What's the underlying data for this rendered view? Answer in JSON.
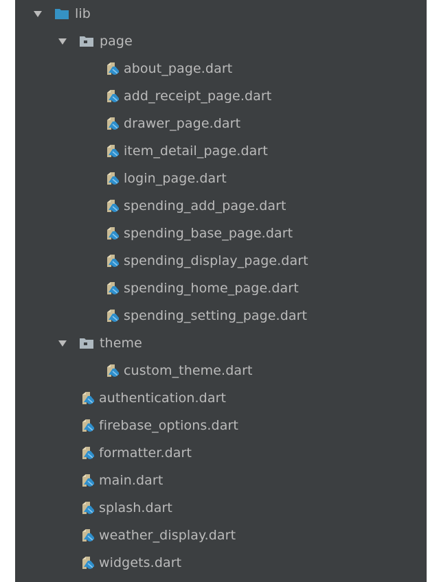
{
  "colors": {
    "background": "#3c3f41",
    "text": "#bbbbbb",
    "root_folder": "#3592c4",
    "package_folder": "#aeb9c0",
    "dart_file_tan": "#c9bb95",
    "dart_file_blue": "#2e8fcc"
  },
  "tree": [
    {
      "type": "folder",
      "label": "lib",
      "icon": "folder-icon",
      "expanded": true,
      "depth": 0
    },
    {
      "type": "package",
      "label": "page",
      "icon": "package-folder-icon",
      "expanded": true,
      "depth": 1
    },
    {
      "type": "file",
      "label": "about_page.dart",
      "icon": "dart-file-icon",
      "depth": 2
    },
    {
      "type": "file",
      "label": "add_receipt_page.dart",
      "icon": "dart-file-icon",
      "depth": 2
    },
    {
      "type": "file",
      "label": "drawer_page.dart",
      "icon": "dart-file-icon",
      "depth": 2
    },
    {
      "type": "file",
      "label": "item_detail_page.dart",
      "icon": "dart-file-icon",
      "depth": 2
    },
    {
      "type": "file",
      "label": "login_page.dart",
      "icon": "dart-file-icon",
      "depth": 2
    },
    {
      "type": "file",
      "label": "spending_add_page.dart",
      "icon": "dart-file-icon",
      "depth": 2
    },
    {
      "type": "file",
      "label": "spending_base_page.dart",
      "icon": "dart-file-icon",
      "depth": 2
    },
    {
      "type": "file",
      "label": "spending_display_page.dart",
      "icon": "dart-file-icon",
      "depth": 2
    },
    {
      "type": "file",
      "label": "spending_home_page.dart",
      "icon": "dart-file-icon",
      "depth": 2
    },
    {
      "type": "file",
      "label": "spending_setting_page.dart",
      "icon": "dart-file-icon",
      "depth": 2
    },
    {
      "type": "package",
      "label": "theme",
      "icon": "package-folder-icon",
      "expanded": true,
      "depth": 1
    },
    {
      "type": "file",
      "label": "custom_theme.dart",
      "icon": "dart-file-icon",
      "depth": 2
    },
    {
      "type": "file",
      "label": "authentication.dart",
      "icon": "dart-file-icon",
      "depth": 1
    },
    {
      "type": "file",
      "label": "firebase_options.dart",
      "icon": "dart-file-icon",
      "depth": 1
    },
    {
      "type": "file",
      "label": "formatter.dart",
      "icon": "dart-file-icon",
      "depth": 1
    },
    {
      "type": "file",
      "label": "main.dart",
      "icon": "dart-file-icon",
      "depth": 1
    },
    {
      "type": "file",
      "label": "splash.dart",
      "icon": "dart-file-icon",
      "depth": 1
    },
    {
      "type": "file",
      "label": "weather_display.dart",
      "icon": "dart-file-icon",
      "depth": 1
    },
    {
      "type": "file",
      "label": "widgets.dart",
      "icon": "dart-file-icon",
      "depth": 1
    }
  ]
}
